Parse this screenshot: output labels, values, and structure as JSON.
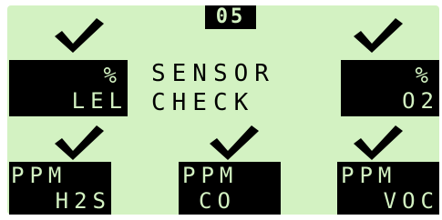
{
  "display": {
    "counter": "05",
    "title_line1": "SENSOR",
    "title_line2": "CHECK"
  },
  "sensors": [
    {
      "unit": "%",
      "name": "LEL",
      "status_icon": "checkmark-icon"
    },
    {
      "unit": "%",
      "name": "O2",
      "status_icon": "checkmark-icon"
    },
    {
      "unit": "PPM",
      "name": "H2S",
      "status_icon": "checkmark-icon"
    },
    {
      "unit": "PPM",
      "name": "CO",
      "status_icon": "checkmark-icon"
    },
    {
      "unit": "PPM",
      "name": "VOC",
      "status_icon": "checkmark-icon"
    }
  ],
  "colors": {
    "lcd_background": "#d3f2c2",
    "pixel_on": "#000000"
  }
}
